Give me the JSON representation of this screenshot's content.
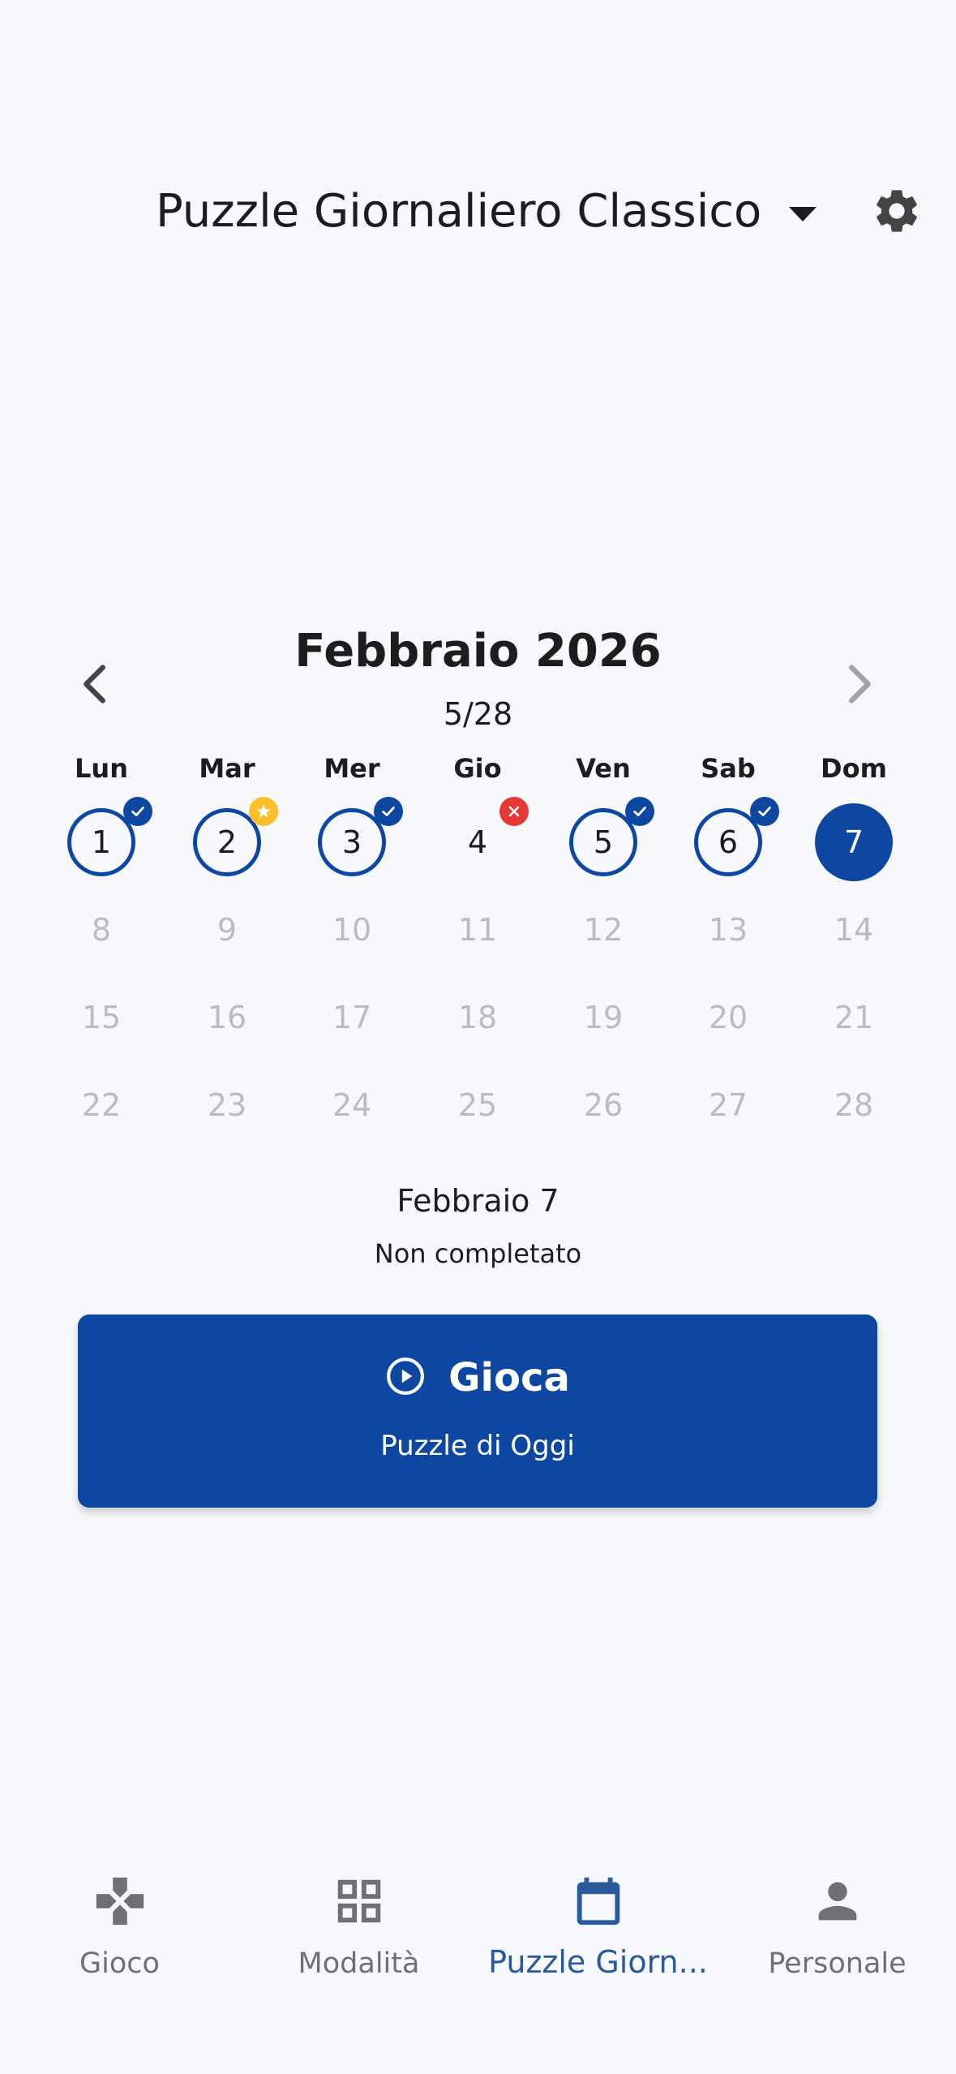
{
  "header": {
    "title": "Puzzle Giornaliero Classico",
    "dropdown_icon": "caret-down-icon",
    "settings_icon": "gear-icon"
  },
  "calendar": {
    "month_title": "Febbraio 2026",
    "progress": "5/28",
    "prev_icon": "chevron-left-icon",
    "next_icon": "chevron-right-icon",
    "weekdays": [
      "Lun",
      "Mar",
      "Mer",
      "Gio",
      "Ven",
      "Sab",
      "Dom"
    ],
    "days": [
      {
        "num": "1",
        "state": "completed"
      },
      {
        "num": "2",
        "state": "starred"
      },
      {
        "num": "3",
        "state": "completed"
      },
      {
        "num": "4",
        "state": "failed"
      },
      {
        "num": "5",
        "state": "completed"
      },
      {
        "num": "6",
        "state": "completed"
      },
      {
        "num": "7",
        "state": "today"
      },
      {
        "num": "8",
        "state": "future"
      },
      {
        "num": "9",
        "state": "future"
      },
      {
        "num": "10",
        "state": "future"
      },
      {
        "num": "11",
        "state": "future"
      },
      {
        "num": "12",
        "state": "future"
      },
      {
        "num": "13",
        "state": "future"
      },
      {
        "num": "14",
        "state": "future"
      },
      {
        "num": "15",
        "state": "future"
      },
      {
        "num": "16",
        "state": "future"
      },
      {
        "num": "17",
        "state": "future"
      },
      {
        "num": "18",
        "state": "future"
      },
      {
        "num": "19",
        "state": "future"
      },
      {
        "num": "20",
        "state": "future"
      },
      {
        "num": "21",
        "state": "future"
      },
      {
        "num": "22",
        "state": "future"
      },
      {
        "num": "23",
        "state": "future"
      },
      {
        "num": "24",
        "state": "future"
      },
      {
        "num": "25",
        "state": "future"
      },
      {
        "num": "26",
        "state": "future"
      },
      {
        "num": "27",
        "state": "future"
      },
      {
        "num": "28",
        "state": "future"
      }
    ]
  },
  "selection": {
    "date": "Febbraio 7",
    "status": "Non completato"
  },
  "play_button": {
    "icon": "play-circle-icon",
    "label": "Gioca",
    "sublabel": "Puzzle di Oggi"
  },
  "bottom_nav": {
    "tabs": [
      {
        "label": "Gioco",
        "icon": "gamepad-icon",
        "active": false
      },
      {
        "label": "Modalità",
        "icon": "grid-icon",
        "active": false
      },
      {
        "label": "Puzzle Giorn...",
        "icon": "calendar-icon",
        "active": true
      },
      {
        "label": "Personale",
        "icon": "person-icon",
        "active": false
      }
    ]
  },
  "colors": {
    "primary": "#0d47a1",
    "star": "#fbc02d",
    "fail": "#e53935",
    "background": "#f7f8fc"
  }
}
